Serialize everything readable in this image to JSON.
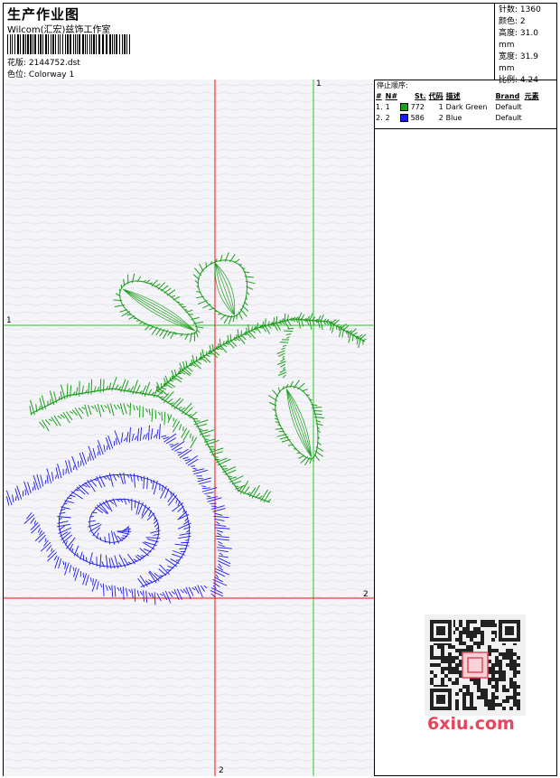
{
  "header": {
    "title": "生产作业图",
    "studio": "Wilcom(汇宏)兹饰工作室",
    "design_label": "花版:",
    "design_file": "2144752.dst",
    "colorway_label": "色位:",
    "colorway_value": "Colorway 1"
  },
  "stats": [
    {
      "label": "针数:",
      "value": "1360"
    },
    {
      "label": "颜色:",
      "value": "2"
    },
    {
      "label": "高度:",
      "value": "31.0 mm"
    },
    {
      "label": "宽度:",
      "value": "31.9 mm"
    },
    {
      "label": "比例:",
      "value": "4.24"
    }
  ],
  "stop_sequence": {
    "title": "停止顺序:",
    "columns": [
      "#",
      "N#",
      "St.",
      "代码",
      "描述",
      "Brand",
      "元素"
    ],
    "rows": [
      {
        "index": "1.",
        "n": "1",
        "color": "#1e9e1e",
        "stitches": "772",
        "code": "1",
        "description": "Dark Green",
        "brand": "Default"
      },
      {
        "index": "2.",
        "n": "2",
        "color": "#1a1aee",
        "stitches": "586",
        "code": "2",
        "description": "Blue",
        "brand": "Default"
      }
    ]
  },
  "guides": {
    "green_label_top": "1",
    "green_label_left": "1",
    "red_label_right": "2",
    "red_label_bottom": "2"
  },
  "colors": {
    "green_thread": "#1e9e1e",
    "blue_thread": "#1a1aee",
    "guide_green": "#22cc22",
    "guide_red": "#ee1111",
    "canvas": "#f5f4f8"
  },
  "watermark": {
    "site": "6xiu.com"
  }
}
